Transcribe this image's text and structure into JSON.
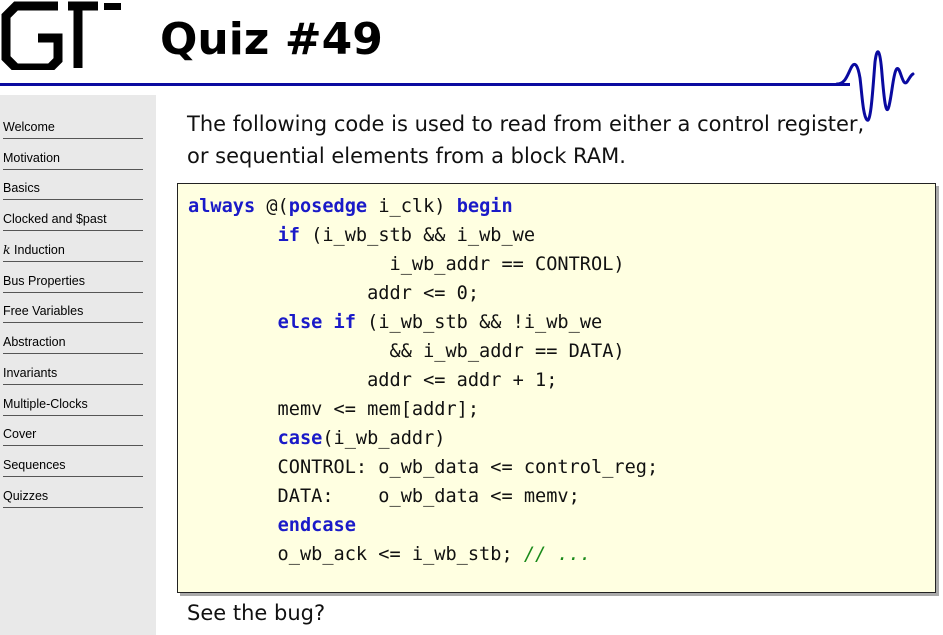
{
  "slide": {
    "title": "Quiz #49",
    "intro_line1": "The following code is used to read from either a control register,",
    "intro_line2": "or sequential elements from a block RAM.",
    "outro": "See the bug?"
  },
  "sidebar": {
    "items": [
      {
        "label": "Welcome"
      },
      {
        "label": "Motivation"
      },
      {
        "label": "Basics"
      },
      {
        "label": "Clocked and $past"
      },
      {
        "label_var": "k",
        "label": " Induction"
      },
      {
        "label": "Bus Properties"
      },
      {
        "label": "Free Variables"
      },
      {
        "label": "Abstraction"
      },
      {
        "label": "Invariants"
      },
      {
        "label": "Multiple-Clocks"
      },
      {
        "label": "Cover"
      },
      {
        "label": "Sequences"
      },
      {
        "label": "Quizzes"
      }
    ]
  },
  "code": {
    "lines": [
      [
        {
          "t": "always",
          "k": true
        },
        {
          "t": " @("
        },
        {
          "t": "posedge",
          "k": true
        },
        {
          "t": " i_clk) "
        },
        {
          "t": "begin",
          "k": true
        }
      ],
      [
        {
          "t": "        "
        },
        {
          "t": "if",
          "k": true
        },
        {
          "t": " (i_wb_stb && i_wb_we"
        }
      ],
      [
        {
          "t": "                  i_wb_addr == CONTROL)"
        }
      ],
      [
        {
          "t": "                addr <= 0;"
        }
      ],
      [
        {
          "t": "        "
        },
        {
          "t": "else",
          "k": true
        },
        {
          "t": " "
        },
        {
          "t": "if",
          "k": true
        },
        {
          "t": " (i_wb_stb && !i_wb_we"
        }
      ],
      [
        {
          "t": "                  && i_wb_addr == DATA)"
        }
      ],
      [
        {
          "t": "                addr <= addr + 1;"
        }
      ],
      [
        {
          "t": "        memv <= mem[addr];"
        }
      ],
      [
        {
          "t": "        "
        },
        {
          "t": "case",
          "k": true
        },
        {
          "t": "(i_wb_addr)"
        }
      ],
      [
        {
          "t": "        CONTROL: o_wb_data <= control_reg;"
        }
      ],
      [
        {
          "t": "        DATA:    o_wb_data <= memv;"
        }
      ],
      [
        {
          "t": "        "
        },
        {
          "t": "endcase",
          "k": true
        }
      ],
      [
        {
          "t": "        o_wb_ack <= i_wb_stb; "
        },
        {
          "t": "// ...",
          "c": true
        }
      ]
    ]
  },
  "colors": {
    "accent": "#0a0aa0",
    "keyword": "#1a1ac8",
    "comment": "#1a8a1a",
    "code_background": "#ffffe1",
    "sidebar_background": "#e9e9e9"
  },
  "logo": {
    "text": "GT"
  }
}
